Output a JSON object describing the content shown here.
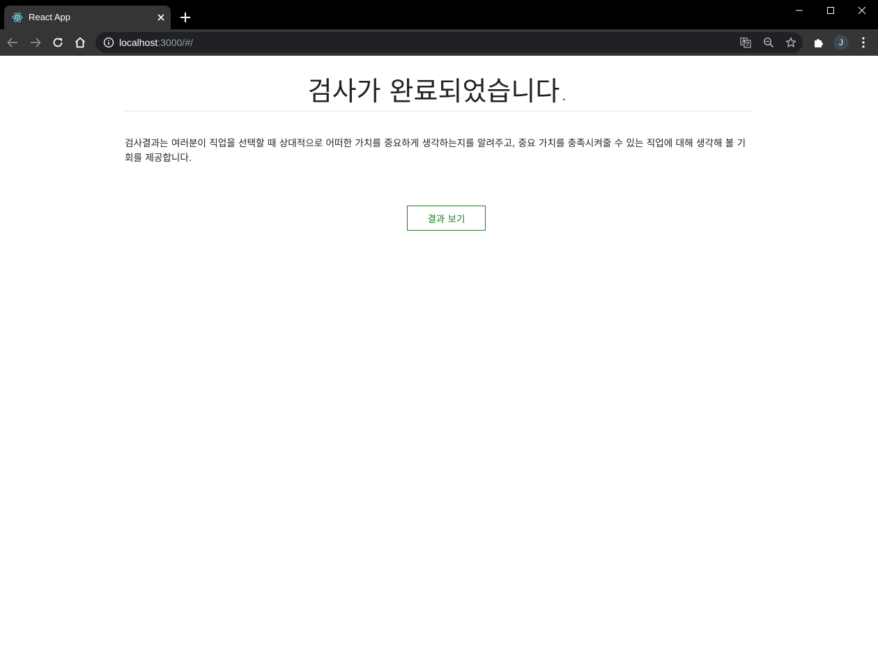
{
  "browser": {
    "tab": {
      "title": "React App",
      "favicon": "react-logo-icon"
    },
    "address": {
      "host": "localhost",
      "rest": ":3000/#/"
    },
    "profile": {
      "initial": "J"
    },
    "colors": {
      "titlebar": "#000000",
      "toolbar": "#353535",
      "omnibox": "#202124"
    }
  },
  "page": {
    "heading": "검사가 완료되었습니다.",
    "description": "검사결과는 여러분이 직업을 선택할 때 상대적으로 어떠한 가치를 중요하게 생각하는지를 알려주고, 중요 가치를 충족시켜줄 수 있는 직업에 대해 생각해 볼 기회를 제공합니다.",
    "result_button": "결과 보기",
    "colors": {
      "accent": "#1f7a1f",
      "text": "#222222"
    }
  }
}
